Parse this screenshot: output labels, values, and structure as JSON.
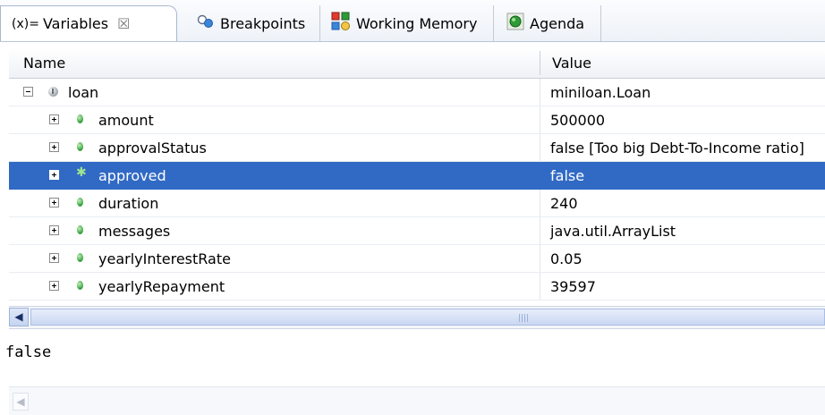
{
  "tabs": [
    {
      "glyph": "(x)=",
      "label": "Variables",
      "close": "☒",
      "icon": "variables-icon",
      "active": true
    },
    {
      "label": "Breakpoints",
      "icon": "breakpoints-icon",
      "active": false
    },
    {
      "label": "Working Memory",
      "icon": "working-memory-icon",
      "active": false
    },
    {
      "label": "Agenda",
      "icon": "agenda-icon",
      "active": false
    }
  ],
  "table": {
    "columns": {
      "name": "Name",
      "value": "Value"
    },
    "rows": [
      {
        "name": "loan",
        "value": "miniloan.Loan",
        "level": 0,
        "expanded": true,
        "icon": "object-icon"
      },
      {
        "name": "amount",
        "value": "500000",
        "level": 1,
        "icon": "field-icon"
      },
      {
        "name": "approvalStatus",
        "value": "false [Too big Debt-To-Income ratio]",
        "level": 1,
        "icon": "field-icon"
      },
      {
        "name": "approved",
        "value": "false",
        "level": 1,
        "icon": "field-changed-icon",
        "selected": true
      },
      {
        "name": "duration",
        "value": "240",
        "level": 1,
        "icon": "field-icon"
      },
      {
        "name": "messages",
        "value": "java.util.ArrayList",
        "level": 1,
        "icon": "field-icon"
      },
      {
        "name": "yearlyInterestRate",
        "value": "0.05",
        "level": 1,
        "icon": "field-icon"
      },
      {
        "name": "yearlyRepayment",
        "value": "39597",
        "level": 1,
        "icon": "field-icon"
      }
    ]
  },
  "detail": {
    "text": "false"
  },
  "colors": {
    "selection": "#316ac5",
    "field_dot": "#2f9b37",
    "tab_border": "#a8b7cf"
  }
}
